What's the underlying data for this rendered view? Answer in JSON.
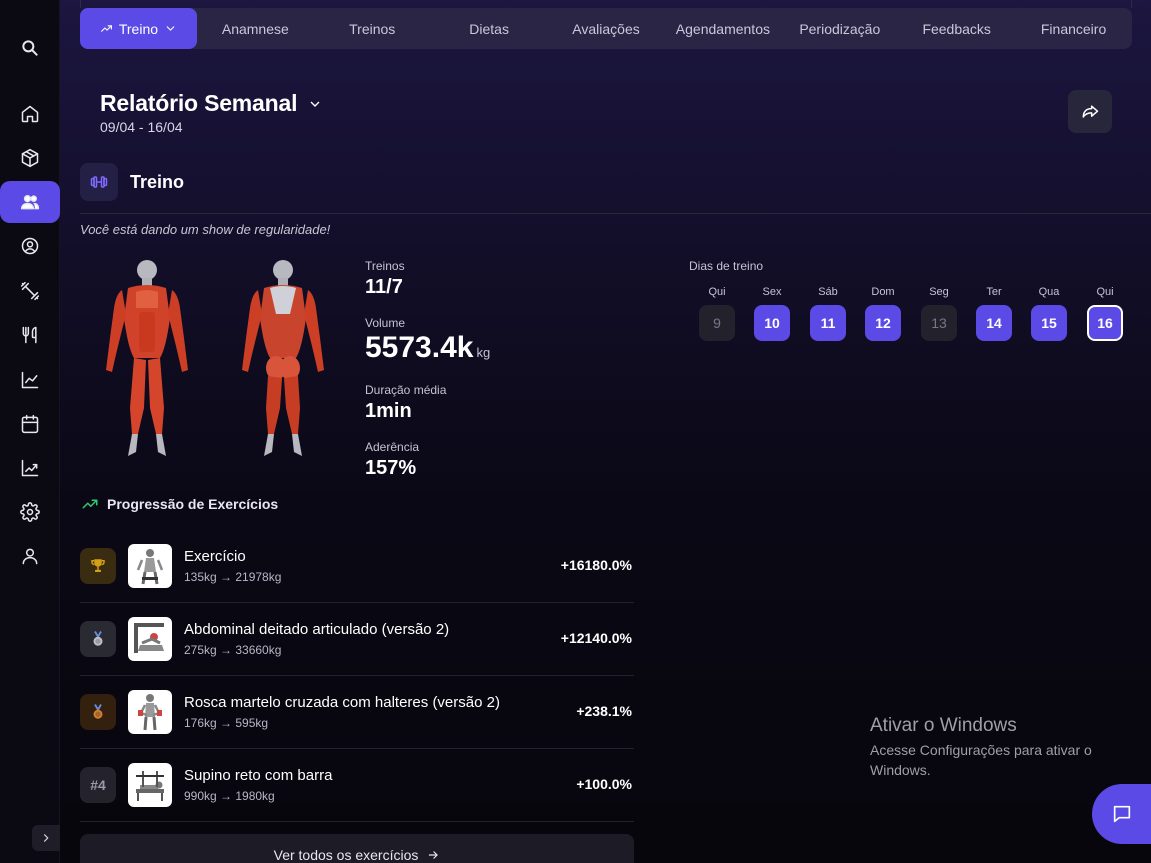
{
  "nav": {
    "tabs": [
      {
        "label": "Treino"
      },
      {
        "label": "Anamnese"
      },
      {
        "label": "Treinos"
      },
      {
        "label": "Dietas"
      },
      {
        "label": "Avaliações"
      },
      {
        "label": "Agendamentos"
      },
      {
        "label": "Periodização"
      },
      {
        "label": "Feedbacks"
      },
      {
        "label": "Financeiro"
      }
    ],
    "active_tab": "Treino"
  },
  "report": {
    "title": "Relatório Semanal",
    "range": "09/04 - 16/04"
  },
  "section": {
    "title": "Treino",
    "motivation": "Você está dando um show de regularidade!"
  },
  "stats": {
    "workouts_label": "Treinos",
    "workouts_value": "11/7",
    "volume_label": "Volume",
    "volume_value": "5573.4k",
    "volume_unit": "kg",
    "duration_label": "Duração média",
    "duration_value": "1min",
    "adherence_label": "Aderência",
    "adherence_value": "157%"
  },
  "days": {
    "label": "Dias de treino",
    "items": [
      {
        "name": "Qui",
        "num": "9",
        "trained": false
      },
      {
        "name": "Sex",
        "num": "10",
        "trained": true
      },
      {
        "name": "Sáb",
        "num": "11",
        "trained": true
      },
      {
        "name": "Dom",
        "num": "12",
        "trained": true
      },
      {
        "name": "Seg",
        "num": "13",
        "trained": false
      },
      {
        "name": "Ter",
        "num": "14",
        "trained": true
      },
      {
        "name": "Qua",
        "num": "15",
        "trained": true
      },
      {
        "name": "Qui",
        "num": "16",
        "trained": true,
        "today": true
      }
    ]
  },
  "progression": {
    "title": "Progressão de Exercícios",
    "items": [
      {
        "rank": "gold",
        "name": "Exercício",
        "detail": "135kg → 21978kg",
        "pct": "+16180.0%"
      },
      {
        "rank": "silver",
        "name": "Abdominal deitado articulado (versão 2)",
        "detail": "275kg → 33660kg",
        "pct": "+12140.0%"
      },
      {
        "rank": "bronze",
        "name": "Rosca martelo cruzada com halteres (versão 2)",
        "detail": "176kg → 595kg",
        "pct": "+238.1%"
      },
      {
        "rank": "#4",
        "name": "Supino reto com barra",
        "detail": "990kg → 1980kg",
        "pct": "+100.0%"
      }
    ],
    "view_all": "Ver todos os exercícios"
  },
  "watermark": {
    "title": "Ativar o Windows",
    "text": "Acesse Configurações para ativar o Windows."
  },
  "colors": {
    "accent": "#5b4ae6",
    "gold": "#d4a017",
    "silver": "#c0c0c8",
    "bronze": "#cd7f32",
    "trend": "#2ecc71"
  }
}
